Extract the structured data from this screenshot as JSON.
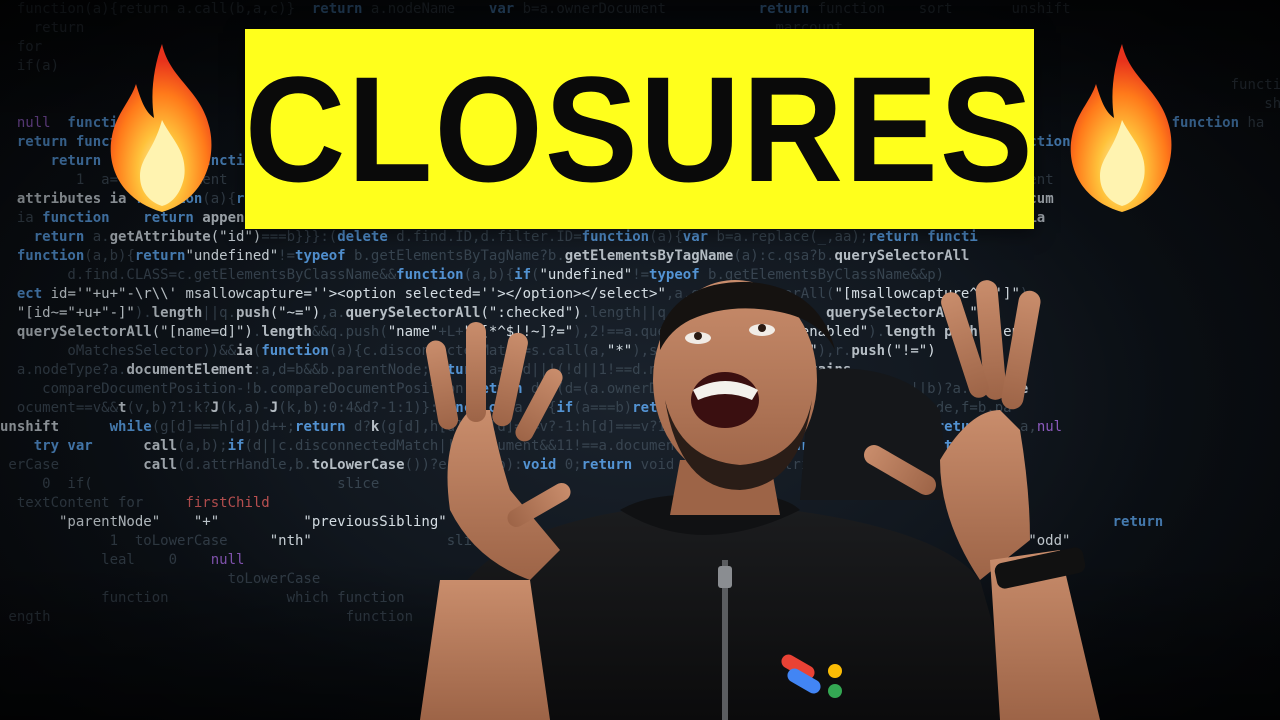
{
  "thumbnail": {
    "title": "CLOSURES"
  },
  "icons": {
    "left": "fire-icon",
    "right": "fire-icon"
  },
  "colors": {
    "banner": "#ffff1c",
    "title_text": "#0a0a0a",
    "background": "#0b0f14"
  }
}
